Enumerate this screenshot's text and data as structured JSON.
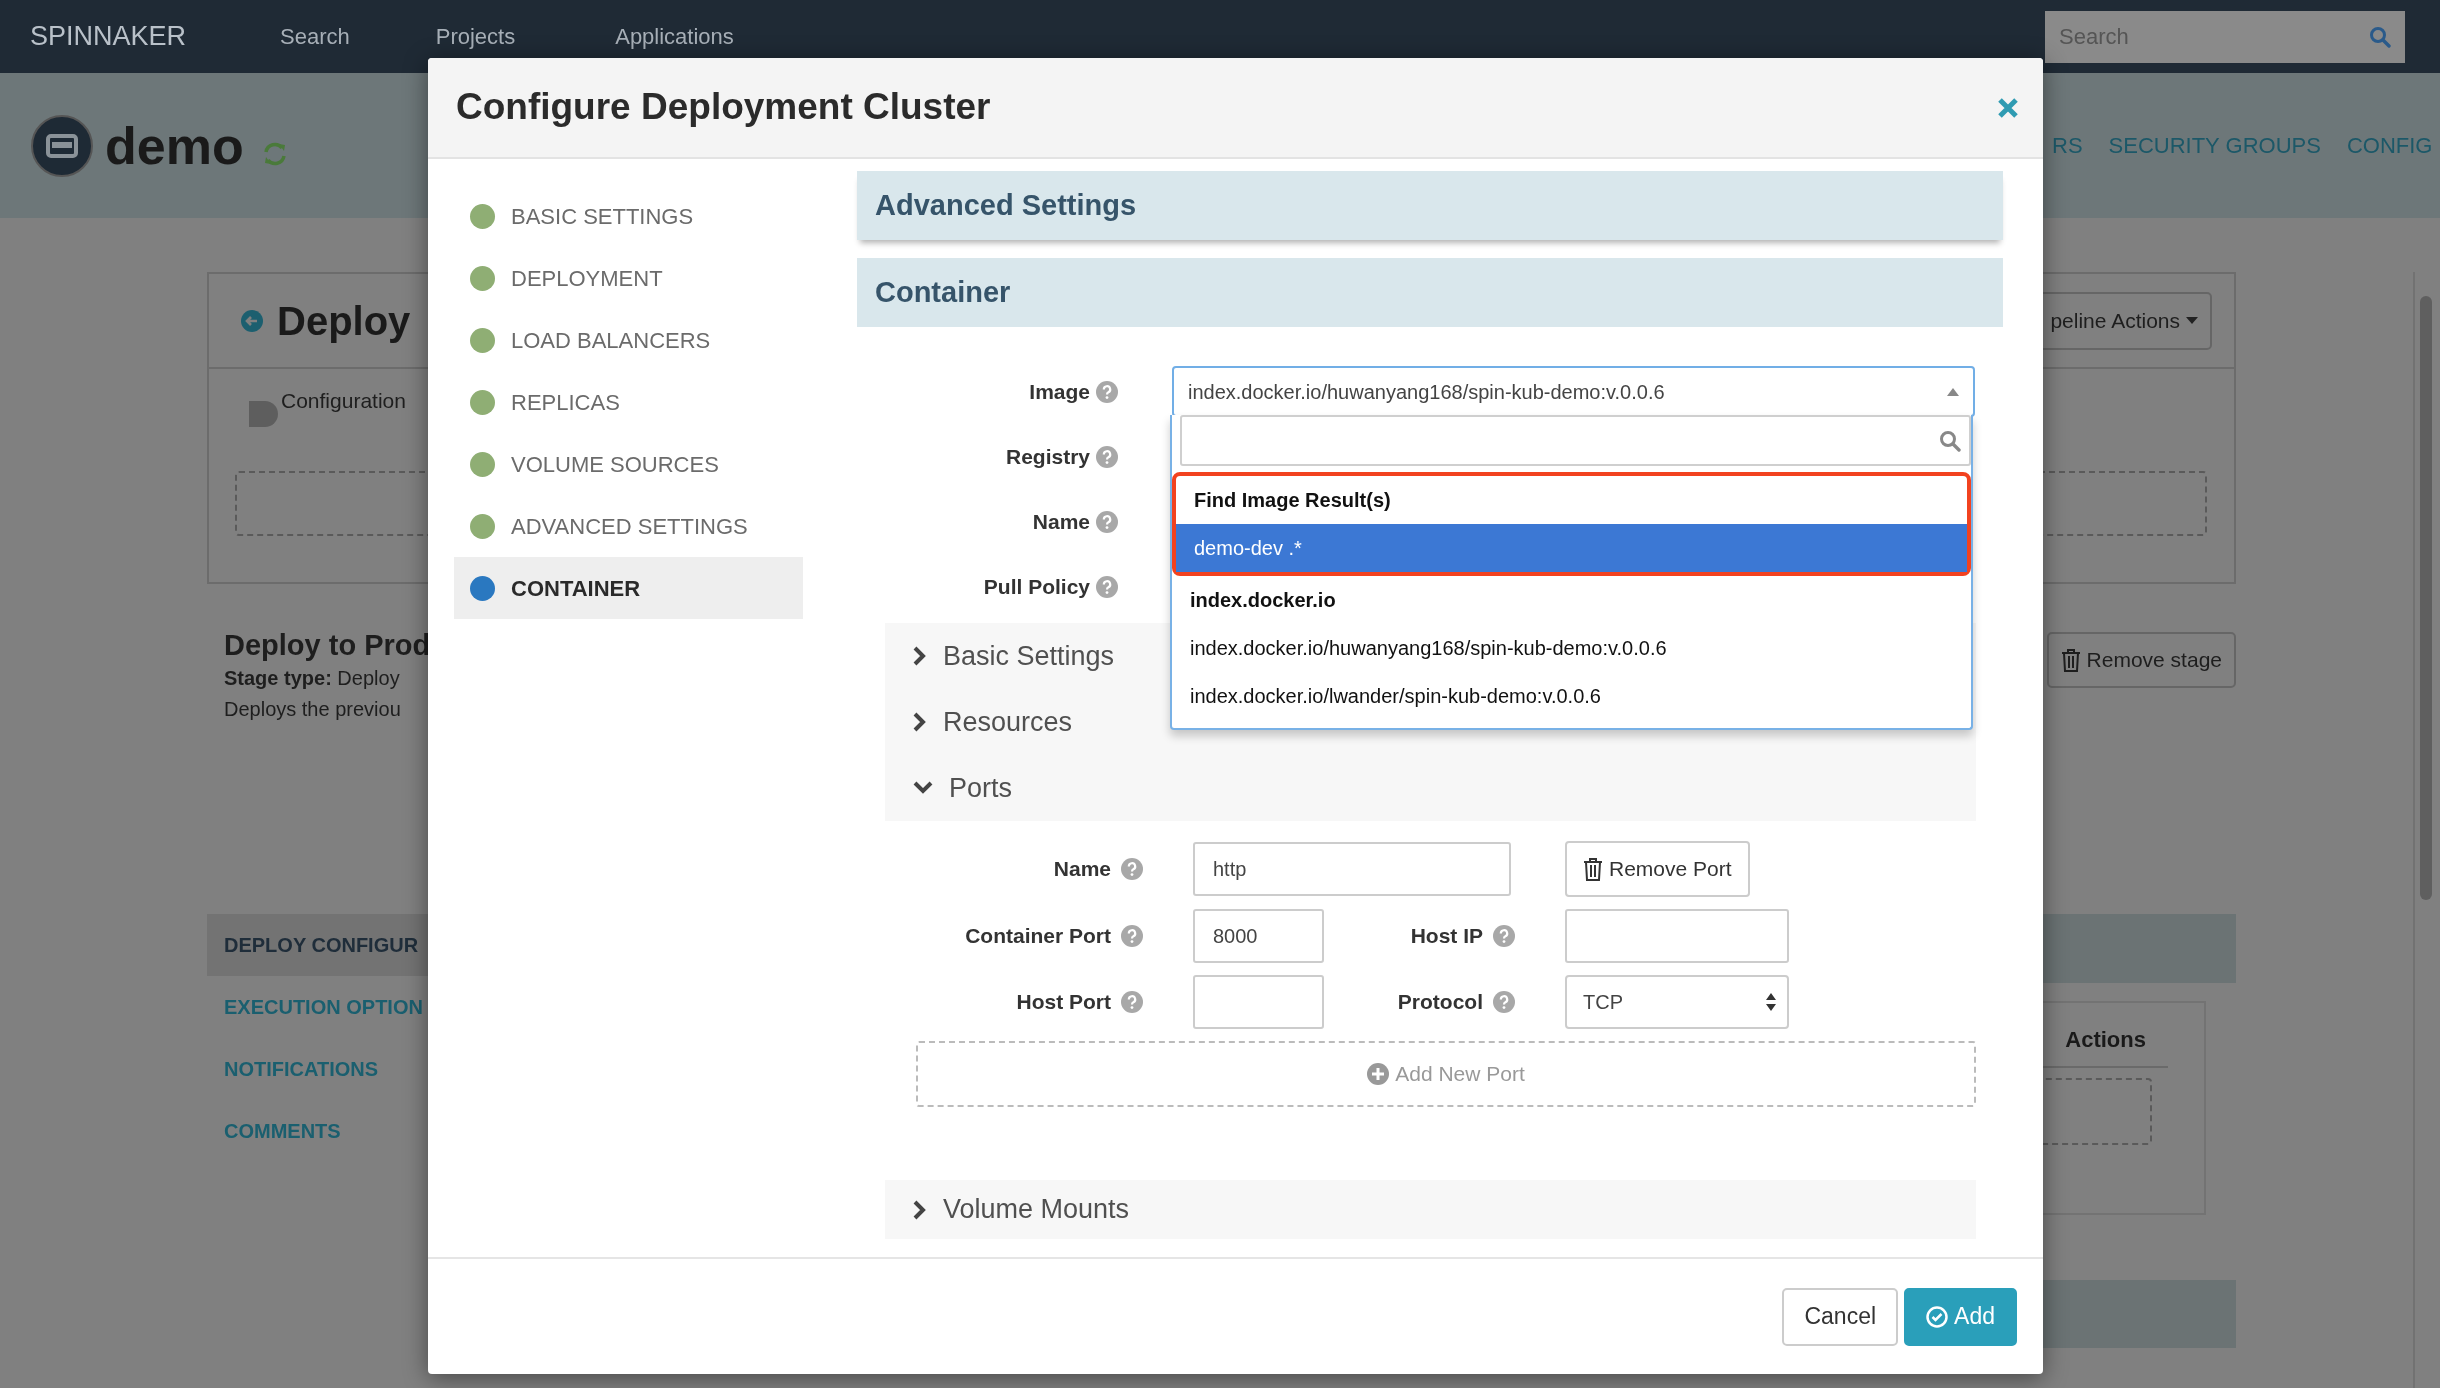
{
  "topbar": {
    "brand": "SPINNAKER",
    "links": [
      "Search",
      "Projects",
      "Applications"
    ],
    "search_placeholder": "Search"
  },
  "app": {
    "name": "demo",
    "tabs": [
      "RS",
      "SECURITY GROUPS",
      "CONFIG"
    ]
  },
  "stage_panel": {
    "title": "Deploy",
    "pipeline_actions": "peline Actions",
    "configuration": "Configuration",
    "name": "Deploy to Prod",
    "type": "**Stage type:** Deploy",
    "description": "Deploys the previou",
    "remove_stage": "Remove stage"
  },
  "stage_nav": [
    {
      "label": "DEPLOY CONFIGUR",
      "selected": true
    },
    {
      "label": "EXECUTION OPTION",
      "selected": false
    },
    {
      "label": "NOTIFICATIONS",
      "selected": false
    },
    {
      "label": "COMMENTS",
      "selected": false
    }
  ],
  "cluster_table": {
    "actions_header": "Actions"
  },
  "modal": {
    "title": "Configure Deployment Cluster",
    "nav": [
      {
        "label": "BASIC SETTINGS",
        "selected": false
      },
      {
        "label": "DEPLOYMENT",
        "selected": false
      },
      {
        "label": "LOAD BALANCERS",
        "selected": false
      },
      {
        "label": "REPLICAS",
        "selected": false
      },
      {
        "label": "VOLUME SOURCES",
        "selected": false
      },
      {
        "label": "ADVANCED SETTINGS",
        "selected": false
      },
      {
        "label": "CONTAINER",
        "selected": true
      }
    ],
    "advanced_title": "Advanced Settings",
    "container_title": "Container",
    "fields": [
      {
        "label": "Image",
        "kind": "select",
        "value": "index.docker.io/huwanyang168/spin-kub-demo:v.0.0.6",
        "expanded": true
      },
      {
        "label": "Registry",
        "kind": "hidden"
      },
      {
        "label": "Name",
        "kind": "hidden"
      },
      {
        "label": "Pull Policy",
        "kind": "hidden"
      }
    ],
    "image_dropdown": [
      {
        "kind": "header",
        "text": "Find Image Result(s)",
        "outlined": true
      },
      {
        "kind": "option",
        "text": "demo-dev .*",
        "selected": true,
        "outlined": true
      },
      {
        "kind": "header",
        "text": "index.docker.io",
        "outlined": false
      },
      {
        "kind": "option",
        "text": "index.docker.io/huwanyang168/spin-kub-demo:v.0.0.6",
        "selected": false,
        "outlined": false
      },
      {
        "kind": "option",
        "text": "index.docker.io/lwander/spin-kub-demo:v.0.0.6",
        "selected": false,
        "outlined": false
      }
    ],
    "groups": [
      {
        "label": "Basic Settings",
        "expanded": false
      },
      {
        "label": "Resources",
        "expanded": false
      },
      {
        "label": "Ports",
        "expanded": true
      }
    ],
    "ports": {
      "name_label": "Name",
      "name": "http",
      "container_port_label": "Container Port",
      "container_port": "8000",
      "host_port_label": "Host Port",
      "host_ip_label": "Host IP",
      "protocol_label": "Protocol",
      "protocol": "TCP",
      "remove_button": "Remove Port",
      "add_button": "Add New Port"
    },
    "volume_mounts": {
      "label": "Volume Mounts",
      "expanded": false
    },
    "footer": {
      "cancel": "Cancel",
      "submit": "Add"
    }
  }
}
